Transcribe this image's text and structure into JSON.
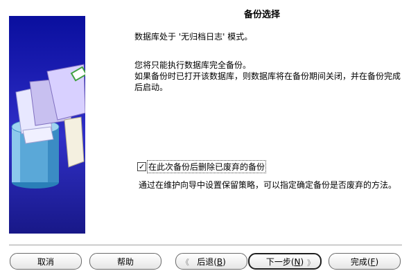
{
  "title": "备份选择",
  "lines": {
    "line1": "数据库处于 '无归档日志' 模式。",
    "line2": "您将只能执行数据库完全备份。",
    "line3": " 如果备份时已打开该数据库，则数据库将在备份期间关闭，并在备份完成",
    "line4": "后启动。"
  },
  "checkbox": {
    "label": "在此次备份后删除已废弃的备份",
    "checked": true,
    "mark": "✓"
  },
  "note": "通过在维护向导中设置保留策略，可以指定确定备份是否废弃的方法。",
  "buttons": {
    "cancel": "取消",
    "help": "帮助",
    "back_label": "后退(",
    "back_key": "B",
    "back_end": ")",
    "next_label": "下一步(",
    "next_key": "N",
    "next_end": ")",
    "finish_label": "完成(",
    "finish_key": "F",
    "finish_end": ")",
    "back_arrow": "《",
    "next_arrow": "》"
  },
  "icons": {
    "banner": "database-backup-illustration",
    "back": "double-chevron-left-icon",
    "next": "double-chevron-right-icon"
  }
}
